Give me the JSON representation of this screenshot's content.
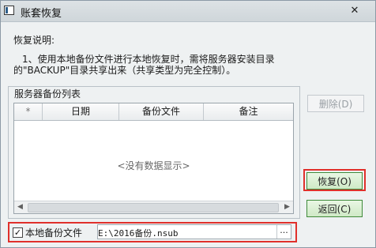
{
  "window": {
    "title": "账套恢复",
    "close_glyph": "✕"
  },
  "description": {
    "title": "恢复说明:",
    "line1": "1、使用本地备份文件进行本地恢复时，需将服务器安装目录",
    "line2": "的\"BACKUP\"目录共享出来（共享类型为完全控制）。"
  },
  "server_backup_list": {
    "label": "服务器备份列表",
    "columns": [
      "*",
      "日期",
      "备份文件",
      "备注"
    ],
    "rows": [],
    "empty_message": "<没有数据显示>"
  },
  "buttons": {
    "delete_label": "删除(D)",
    "restore_label": "恢复(O)",
    "back_label": "返回(C)"
  },
  "local_backup": {
    "checkbox_label": "本地备份文件",
    "checked": true,
    "check_glyph": "✓",
    "path_value": "E:\\2016备份.nsub",
    "browse_label": "..."
  },
  "colors": {
    "highlight_border": "#e0302b",
    "primary_button_border": "#3f8a3a"
  }
}
